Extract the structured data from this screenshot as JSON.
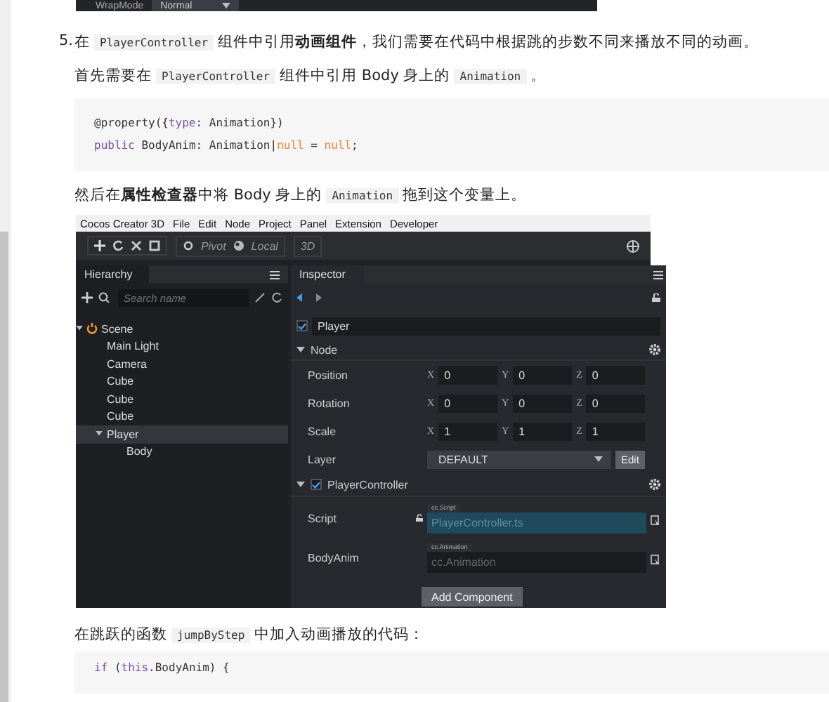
{
  "top_strip": {
    "label": "WrapMode",
    "value": "Normal"
  },
  "step": {
    "number": "5.",
    "segments": [
      {
        "kind": "text",
        "text": "在"
      },
      {
        "kind": "code",
        "text": "PlayerController"
      },
      {
        "kind": "text",
        "text": "组件中引用"
      },
      {
        "kind": "bold",
        "text": "动画组件"
      },
      {
        "kind": "text",
        "text": "，我们需要在代码中根据跳的步数不同来播放不同的动画。"
      }
    ]
  },
  "paragraph_1": {
    "segments": [
      {
        "kind": "text",
        "text": "首先需要在"
      },
      {
        "kind": "code",
        "text": "PlayerController"
      },
      {
        "kind": "text",
        "text": "组件中引用 Body 身上的"
      },
      {
        "kind": "code",
        "text": "Animation"
      },
      {
        "kind": "text",
        "text": "。"
      }
    ]
  },
  "code_block_1": {
    "lines": [
      [
        {
          "kind": "plain",
          "text": "@property({"
        },
        {
          "kind": "keyword",
          "text": "type"
        },
        {
          "kind": "plain",
          "text": ": Animation})"
        }
      ],
      [
        {
          "kind": "keyword",
          "text": "public"
        },
        {
          "kind": "plain",
          "text": " BodyAnim: Animation|"
        },
        {
          "kind": "literal",
          "text": "null"
        },
        {
          "kind": "plain",
          "text": " = "
        },
        {
          "kind": "literal",
          "text": "null"
        },
        {
          "kind": "plain",
          "text": ";"
        }
      ]
    ]
  },
  "paragraph_2": {
    "segments": [
      {
        "kind": "text",
        "text": "然后在"
      },
      {
        "kind": "bold",
        "text": "属性检查器"
      },
      {
        "kind": "text",
        "text": "中将 Body 身上的"
      },
      {
        "kind": "code",
        "text": "Animation"
      },
      {
        "kind": "text",
        "text": "拖到这个变量上。"
      }
    ]
  },
  "editor": {
    "menu_bar": [
      "Cocos Creator 3D",
      "File",
      "Edit",
      "Node",
      "Project",
      "Panel",
      "Extension",
      "Developer"
    ],
    "toolbar": {
      "pivot": "Pivot",
      "local": "Local",
      "mode": "3D"
    },
    "hierarchy": {
      "title": "Hierarchy",
      "search_placeholder": "Search name",
      "tree": [
        {
          "label": "Scene",
          "expanded": true,
          "selected": false,
          "children": [
            {
              "label": "Main Light",
              "selected": false
            },
            {
              "label": "Camera",
              "selected": false
            },
            {
              "label": "Cube",
              "selected": false
            },
            {
              "label": "Cube",
              "selected": false
            },
            {
              "label": "Cube",
              "selected": false
            },
            {
              "label": "Player",
              "expanded": true,
              "selected": true,
              "children": [
                {
                  "label": "Body",
                  "selected": false
                }
              ]
            }
          ]
        }
      ]
    },
    "inspector": {
      "title": "Inspector",
      "node_name": "Player",
      "node_active": true,
      "node_section": "Node",
      "vectors": [
        {
          "label": "Position",
          "values": [
            {
              "axis": "X",
              "value": "0"
            },
            {
              "axis": "Y",
              "value": "0"
            },
            {
              "axis": "Z",
              "value": "0"
            }
          ]
        },
        {
          "label": "Rotation",
          "values": [
            {
              "axis": "X",
              "value": "0"
            },
            {
              "axis": "Y",
              "value": "0"
            },
            {
              "axis": "Z",
              "value": "0"
            }
          ]
        },
        {
          "label": "Scale",
          "values": [
            {
              "axis": "X",
              "value": "1"
            },
            {
              "axis": "Y",
              "value": "1"
            },
            {
              "axis": "Z",
              "value": "1"
            }
          ]
        }
      ],
      "layer": {
        "label": "Layer",
        "value": "DEFAULT",
        "button": "Edit"
      },
      "component": {
        "title": "PlayerController",
        "enabled": true,
        "fields": [
          {
            "label": "Script",
            "tag": "cc.Script",
            "value": "PlayerController.ts",
            "locked": true
          },
          {
            "label": "BodyAnim",
            "tag": "cc.Animation",
            "placeholder": "cc.Animation",
            "locked": false
          }
        ]
      },
      "add_button": "Add Component"
    }
  },
  "paragraph_3": {
    "segments": [
      {
        "kind": "text",
        "text": "在跳跃的函数"
      },
      {
        "kind": "code",
        "text": "jumpByStep"
      },
      {
        "kind": "text",
        "text": "中加入动画播放的代码："
      }
    ]
  },
  "code_block_2": {
    "lines": [
      [
        {
          "kind": "keyword",
          "text": "if"
        },
        {
          "kind": "plain",
          "text": " ("
        },
        {
          "kind": "keyword",
          "text": "this"
        },
        {
          "kind": "plain",
          "text": ".BodyAnim) {"
        }
      ]
    ]
  }
}
